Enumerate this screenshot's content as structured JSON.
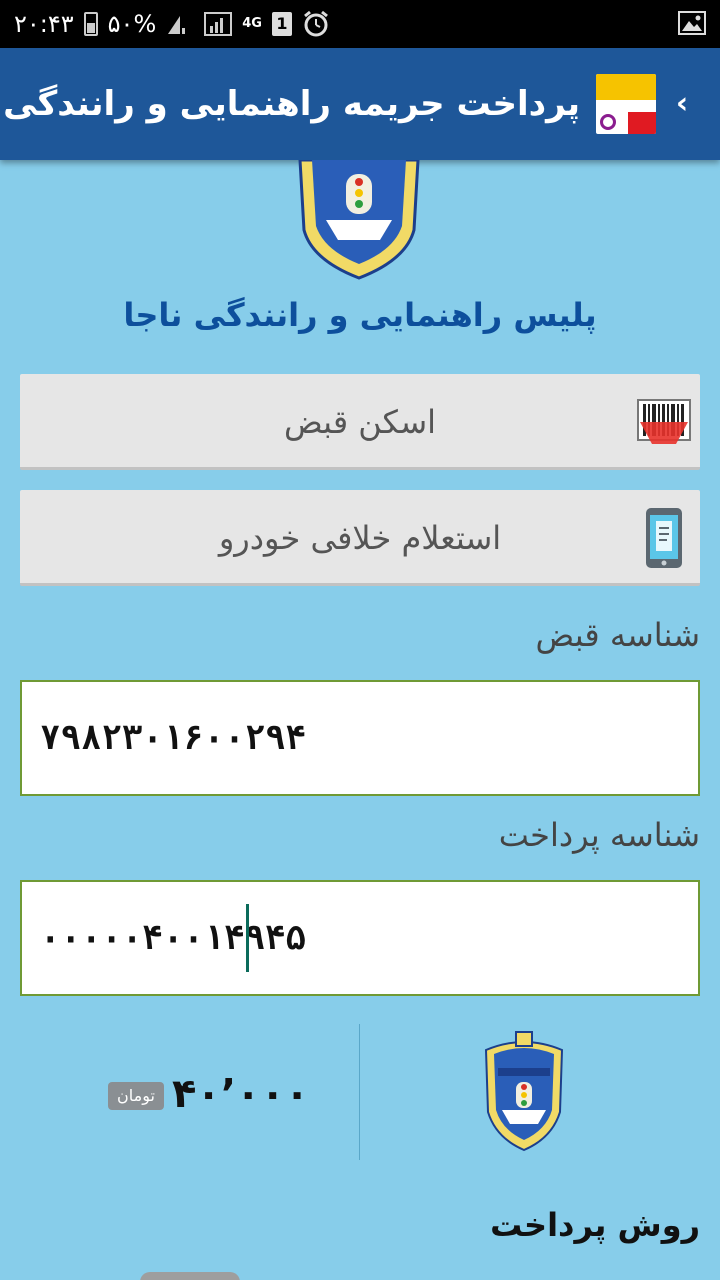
{
  "status_bar": {
    "time": "۲۰:۴۳",
    "battery": "۵۰%",
    "network": "4G",
    "sim_slot": "1",
    "icons": [
      "battery-icon",
      "signal-icon",
      "sim-icon",
      "alarm-icon",
      "gallery-icon"
    ]
  },
  "app_bar": {
    "title": "پرداخت جریمه راهنمایی و رانندگی",
    "logo_icon": "charge-app-logo",
    "back_icon": "chevron-left-icon"
  },
  "header": {
    "org_name": "پلیس راهنمایی و رانندگی ناجا"
  },
  "actions": {
    "scan_label": "اسکن قبض",
    "inquiry_label": "استعلام خلافی خودرو"
  },
  "form": {
    "bill_id_label": "شناسه قبض",
    "bill_id_value": "۷۹۸۲۳۰۱۶۰۰۲۹۴",
    "payment_id_label": "شناسه پرداخت",
    "payment_id_value": "۰۰۰۰۰۴۰۰۱۴۹۴۵"
  },
  "summary": {
    "amount": "۴۰٬۰۰۰",
    "currency": "تومان"
  },
  "payment": {
    "method_label": "روش پرداخت"
  },
  "colors": {
    "background": "#87cdea",
    "app_bar": "#1e5799",
    "title_blue": "#0d4f9c",
    "input_border": "#6f9a35",
    "button_bg": "#e6e6e6"
  }
}
